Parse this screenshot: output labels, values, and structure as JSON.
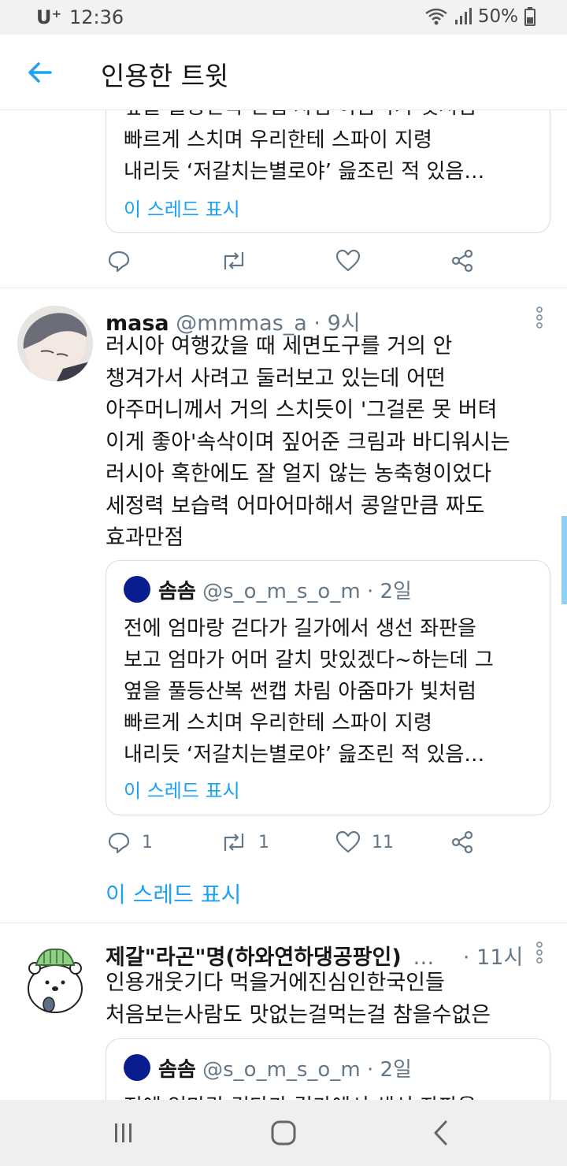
{
  "status": {
    "carrier": "U⁺",
    "time": "12:36",
    "battery": "50%"
  },
  "header": {
    "title": "인용한 트윗",
    "back_icon": "arrow-left-icon"
  },
  "top_quote": {
    "lines": [
      "빠르게 스치며 우리한테 스파이 지령",
      "내리듯 ‘저갈치는별로야’ 읊조린 적 있음…"
    ],
    "partial_line": "옆을 풀등산복 썬캡 차림 아줌마가 빛처럼",
    "show_thread": "이 스레드 표시"
  },
  "tweets": [
    {
      "name": "masa",
      "handle": "@mmmas_a",
      "time": "· 9시",
      "body": [
        "러시아 여행갔을 때 세면도구를 거의 안",
        "챙겨가서 사려고 둘러보고 있는데 어떤",
        "아주머니께서 거의 스치듯이 '그걸론 못 버텨",
        "이게 좋아'속삭이며 짚어준 크림과 바디워시는",
        "러시아 혹한에도 잘 얼지 않는 농축형이었다",
        "세정력 보습력 어마어마해서 콩알만큼 짜도",
        "효과만점"
      ],
      "quote": {
        "name": "솜솜",
        "handle": "@s_o_m_s_o_m",
        "time": "· 2일",
        "lines": [
          "전에 엄마랑 걷다가 길가에서 생선 좌판을",
          "보고 엄마가 어머 갈치 맛있겠다~하는데 그",
          "옆을 풀등산복 썬캡 차림 아줌마가 빛처럼",
          "빠르게 스치며 우리한테 스파이 지령",
          "내리듯 ‘저갈치는별로야’ 읊조린 적 있음…"
        ],
        "show_thread": "이 스레드 표시"
      },
      "stats": {
        "replies": "1",
        "retweets": "1",
        "likes": "11"
      },
      "show_thread": "이 스레드 표시"
    },
    {
      "name": "제갈\"라곤\"명(하와연하댕공팡인)",
      "ellipsis": "…",
      "time": "· 11시",
      "body": [
        "인용개웃기다 먹을거에진심인한국인들",
        "처음보는사람도 맛없는걸먹는걸 참을수없은"
      ],
      "quote": {
        "name": "솜솜",
        "handle": "@s_o_m_s_o_m",
        "time": "· 2일",
        "partial_line": "전에 엄마랑 걷다가 길가에서 생선 좌판을"
      }
    }
  ],
  "colors": {
    "accent": "#1da1f2",
    "muted": "#657786",
    "quote_avatar": "#0a1d8f"
  },
  "icons": [
    "arrow-left-icon",
    "reply-icon",
    "retweet-icon",
    "like-icon",
    "share-icon",
    "more-icon",
    "recent-apps-icon",
    "home-icon",
    "nav-back-icon"
  ]
}
